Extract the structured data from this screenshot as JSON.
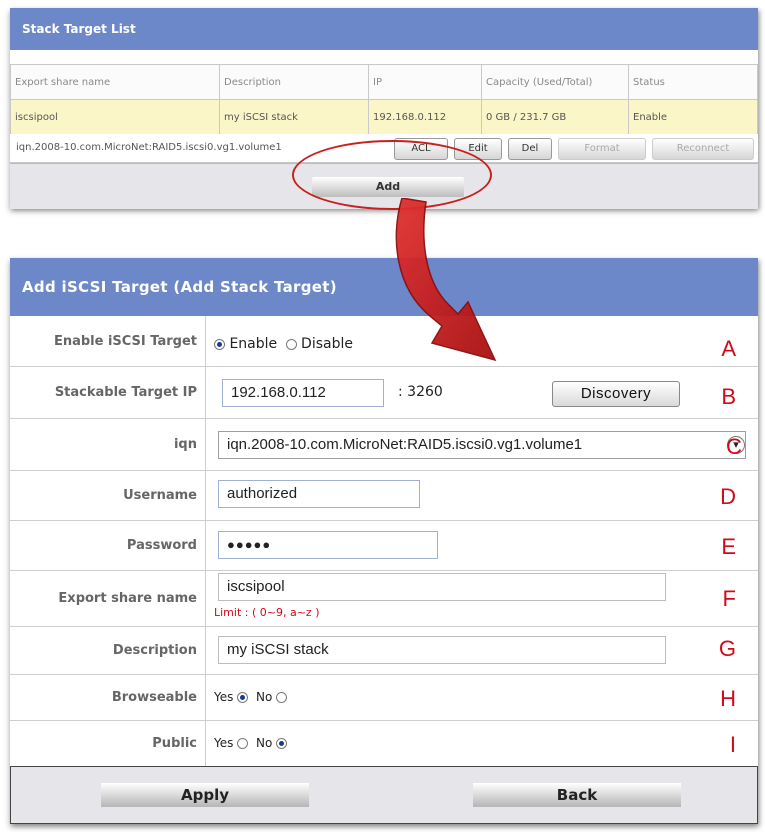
{
  "stack_list": {
    "title": "Stack Target List",
    "columns": [
      "Export share name",
      "Description",
      "IP",
      "Capacity (Used/Total)",
      "Status"
    ],
    "row": {
      "export_share_name": "iscsipool",
      "description": "my iSCSI stack",
      "ip": "192.168.0.112",
      "capacity": "0 GB / 231.7 GB",
      "status": "Enable",
      "iqn": "iqn.2008-10.com.MicroNet:RAID5.iscsi0.vg1.volume1"
    },
    "actions": [
      "ACL",
      "Edit",
      "Del",
      "Format",
      "Reconnect"
    ],
    "add_label": "Add"
  },
  "form": {
    "title": "Add iSCSI Target (Add Stack Target)",
    "enable_label": "Enable iSCSI Target",
    "enable_option": "Enable",
    "disable_option": "Disable",
    "target_ip_label": "Stackable Target IP",
    "target_ip_value": "192.168.0.112",
    "port_text": ": 3260",
    "discovery_label": "Discovery",
    "iqn_label": "iqn",
    "iqn_value": "iqn.2008-10.com.MicroNet:RAID5.iscsi0.vg1.volume1",
    "username_label": "Username",
    "username_value": "authorized",
    "password_label": "Password",
    "password_value": "●●●●●",
    "export_label": "Export share name",
    "export_value": "iscsipool",
    "limit_note": "Limit : ( 0~9, a~z )",
    "description_label": "Description",
    "description_value": "my iSCSI stack",
    "browseable_label": "Browseable",
    "public_label": "Public",
    "yes_text": "Yes",
    "no_text": "No",
    "browseable_selected": "Yes",
    "public_selected": "No",
    "apply_label": "Apply",
    "back_label": "Back"
  },
  "callouts": [
    "A",
    "B",
    "C",
    "D",
    "E",
    "F",
    "G",
    "H",
    "I"
  ],
  "colors": {
    "header_blue": "#6d88c8",
    "callout_red": "#d10a1a",
    "row_highlight": "#fbf6c8"
  }
}
